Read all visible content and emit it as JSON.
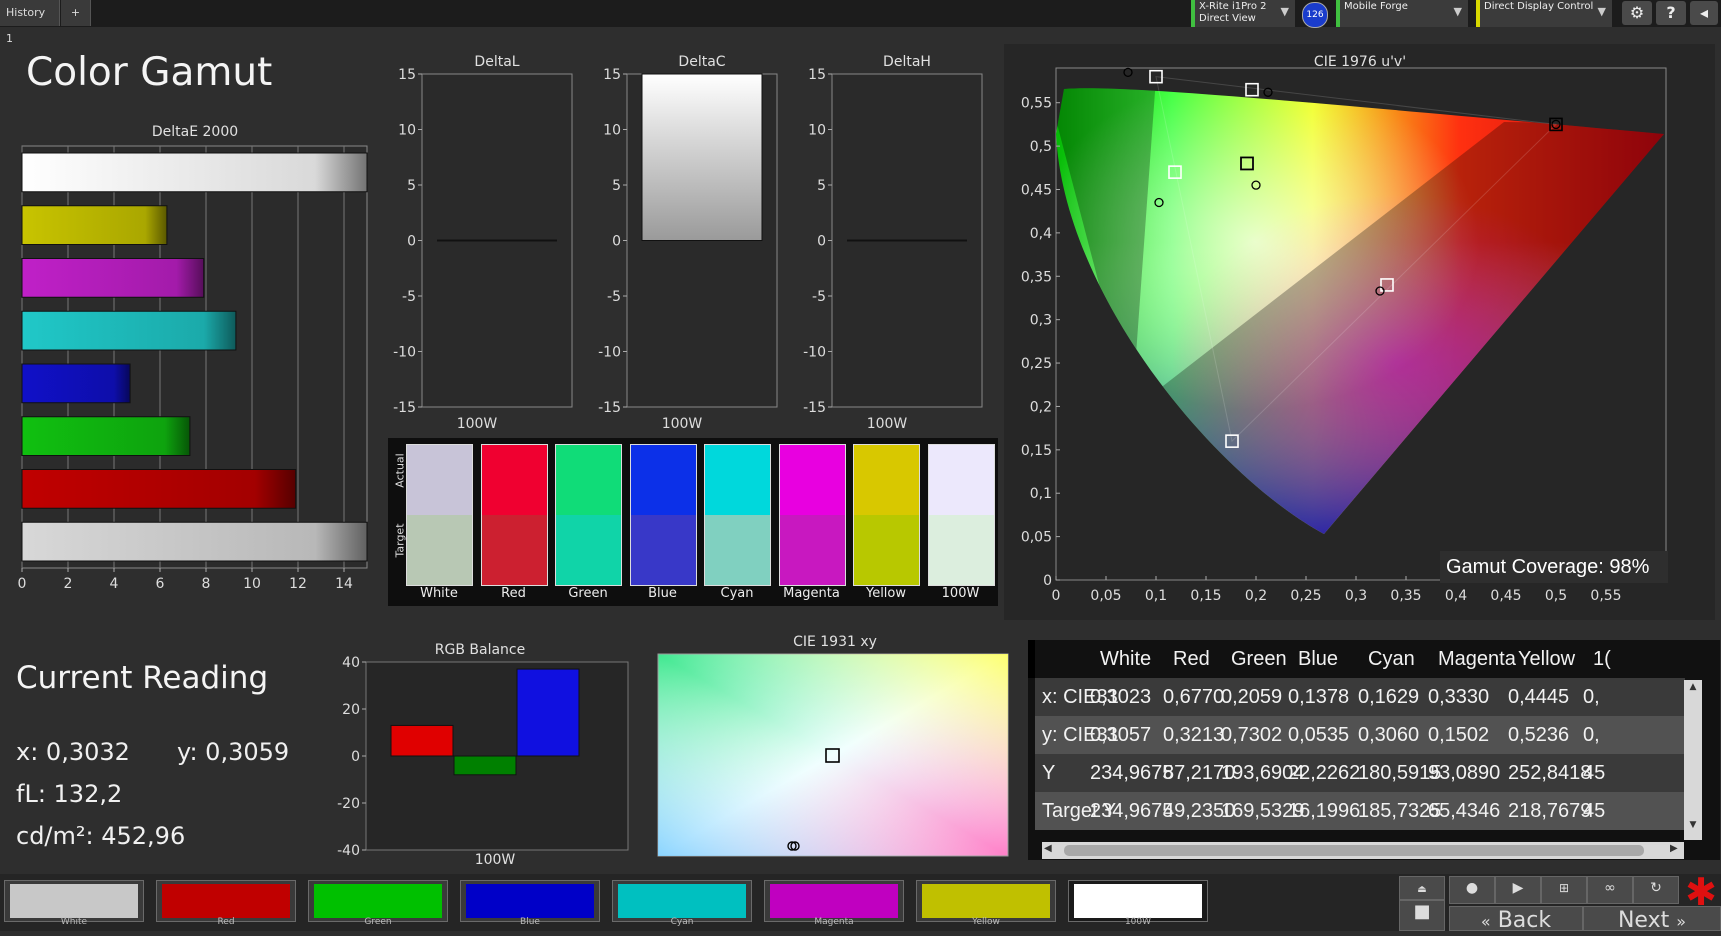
{
  "topbar": {
    "tab_label": "History 1",
    "add_tab": "+",
    "device1_line1": "X-Rite i1Pro 2",
    "device1_line2": "Direct View",
    "badge": "126",
    "device2": "Mobile Forge",
    "device3": "Direct Display Control",
    "settings_glyph": "⚙",
    "help_glyph": "?",
    "collapse_glyph": "◂"
  },
  "title": "Color Gamut",
  "deltae": {
    "title": "DeltaE 2000",
    "ticks": [
      "0",
      "2",
      "4",
      "6",
      "8",
      "10",
      "12",
      "14"
    ],
    "xlim": [
      0,
      15
    ],
    "bars": [
      {
        "name": "white",
        "value": 15,
        "color": "#ffffff"
      },
      {
        "name": "yellow",
        "value": 6.3,
        "color": "#c8c400"
      },
      {
        "name": "magenta",
        "value": 7.9,
        "color": "#c020c8"
      },
      {
        "name": "cyan",
        "value": 9.3,
        "color": "#20c8c8"
      },
      {
        "name": "blue",
        "value": 4.7,
        "color": "#1010c8"
      },
      {
        "name": "green",
        "value": 7.3,
        "color": "#10c010"
      },
      {
        "name": "red",
        "value": 11.9,
        "color": "#c00000"
      },
      {
        "name": "gray",
        "value": 15,
        "color": "#d8d8d8"
      }
    ]
  },
  "delta_charts": [
    {
      "title": "DeltaL",
      "xlabel": "100W",
      "value": 0
    },
    {
      "title": "DeltaC",
      "xlabel": "100W",
      "value": 15
    },
    {
      "title": "DeltaH",
      "xlabel": "100W",
      "value": 0
    }
  ],
  "delta_ticks": [
    "15",
    "10",
    "5",
    "0",
    "-5",
    "-10",
    "-15"
  ],
  "swatches": {
    "actual_label": "Actual",
    "target_label": "Target",
    "items": [
      {
        "label": "White",
        "actual": "#c8c4d8",
        "target": "#b8c8b4"
      },
      {
        "label": "Red",
        "actual": "#f00030",
        "target": "#cc2030"
      },
      {
        "label": "Green",
        "actual": "#10dc78",
        "target": "#10d4a8"
      },
      {
        "label": "Blue",
        "actual": "#0c30e8",
        "target": "#3838c8"
      },
      {
        "label": "Cyan",
        "actual": "#00d8dc",
        "target": "#80d0c0"
      },
      {
        "label": "Magenta",
        "actual": "#e800e0",
        "target": "#c818c0"
      },
      {
        "label": "Yellow",
        "actual": "#d8c800",
        "target": "#b8c800"
      },
      {
        "label": "100W",
        "actual": "#ece8fc",
        "target": "#dceede"
      }
    ]
  },
  "cie1976": {
    "title": "CIE 1976 u'v'",
    "xticks": [
      "0",
      "0,05",
      "0,1",
      "0,15",
      "0,2",
      "0,25",
      "0,3",
      "0,35",
      "0,4",
      "0,45",
      "0,5",
      "0,55"
    ],
    "yticks": [
      "0",
      "0,05",
      "0,1",
      "0,15",
      "0,2",
      "0,25",
      "0,3",
      "0,35",
      "0,4",
      "0,45",
      "0,5",
      "0,55"
    ],
    "coverage_label": "Gamut Coverage:",
    "coverage_value": "98%"
  },
  "current": {
    "title": "Current Reading",
    "x": "x: 0,3032",
    "y": "y: 0,3059",
    "fl": "fL: 132,2",
    "cd": "cd/m²: 452,96"
  },
  "rgb": {
    "title": "RGB Balance",
    "xlabel": "100W",
    "ticks": [
      "40",
      "20",
      "0",
      "-20",
      "-40"
    ],
    "ylim": [
      -40,
      40
    ],
    "values": [
      {
        "name": "red",
        "value": 13,
        "color": "#e00000"
      },
      {
        "name": "green",
        "value": -8,
        "color": "#008000"
      },
      {
        "name": "blue",
        "value": 37,
        "color": "#1010e0"
      }
    ]
  },
  "cie1931": {
    "title": "CIE 1931 xy"
  },
  "table": {
    "headers": [
      "White",
      "Red",
      "Green",
      "Blue",
      "Cyan",
      "Magenta",
      "Yellow",
      "1("
    ],
    "rows": [
      {
        "label": "x: CIE31",
        "vals": [
          "0,3023",
          "0,6770",
          "0,2059",
          "0,1378",
          "0,1629",
          "0,3330",
          "0,4445",
          "0,"
        ]
      },
      {
        "label": "y: CIE31",
        "vals": [
          "0,3057",
          "0,3213",
          "0,7302",
          "0,0535",
          "0,3060",
          "0,1502",
          "0,5236",
          "0,"
        ]
      },
      {
        "label": "Y",
        "vals": [
          "234,9675",
          "87,2170",
          "193,6904",
          "22,2262",
          "180,5915",
          "93,0890",
          "252,8418",
          "45"
        ]
      },
      {
        "label": "Target Y",
        "vals": [
          "234,9675",
          "49,2350",
          "169,5329",
          "16,1996",
          "185,7325",
          "65,4346",
          "218,7679",
          "45"
        ]
      }
    ]
  },
  "bottom": {
    "swatches": [
      {
        "name": "White",
        "color": "#c8c8c8"
      },
      {
        "name": "Red",
        "color": "#c00000"
      },
      {
        "name": "Green",
        "color": "#00c000"
      },
      {
        "name": "Blue",
        "color": "#0000c8"
      },
      {
        "name": "Cyan",
        "color": "#00c0c0"
      },
      {
        "name": "Magenta",
        "color": "#c000c0"
      },
      {
        "name": "Yellow",
        "color": "#c0c000"
      },
      {
        "name": "100W",
        "color": "#ffffff"
      }
    ],
    "back_label": "Back",
    "next_label": "Next"
  }
}
